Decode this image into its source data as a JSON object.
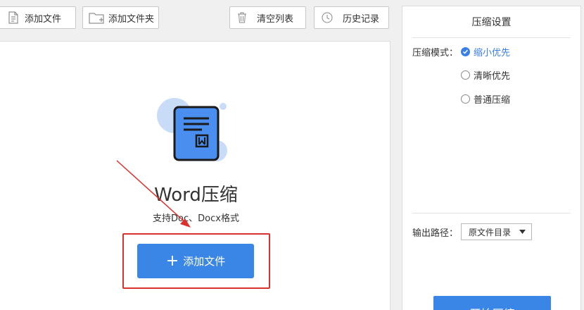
{
  "toolbar": {
    "add_file": "添加文件",
    "add_folder": "添加文件夹",
    "clear_list": "清空列表",
    "history": "历史记录"
  },
  "main": {
    "title": "Word压缩",
    "subtitle": "支持Doc、Docx格式",
    "add_button": "添加文件",
    "add_button_icon": "plus-icon"
  },
  "settings": {
    "title": "压缩设置",
    "mode_label": "压缩模式：",
    "modes": [
      {
        "label": "缩小优先",
        "checked": true
      },
      {
        "label": "清晰优先",
        "checked": false
      },
      {
        "label": "普通压缩",
        "checked": false
      }
    ],
    "output_label": "输出路径：",
    "output_value": "原文件目录",
    "start_button": "开始压缩"
  },
  "colors": {
    "accent": "#3a86e6",
    "annotation": "#d9312c"
  }
}
